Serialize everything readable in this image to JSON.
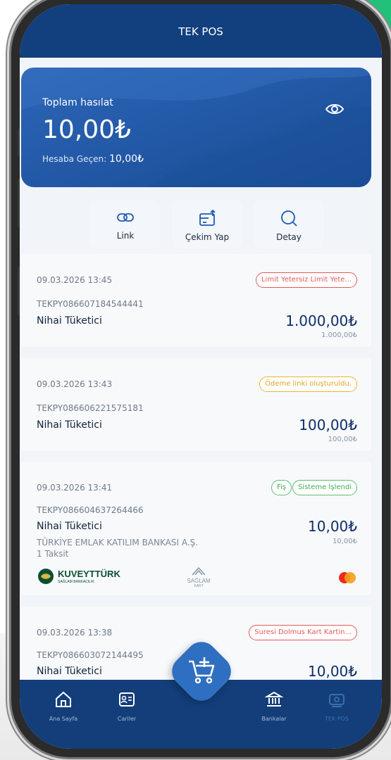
{
  "app": {
    "title": "TEK POS"
  },
  "summary": {
    "total_label": "Toplam hasılat",
    "total_amount": "10,00₺",
    "transferred_label": "Hesaba Geçen:",
    "transferred_amount": "10,00₺"
  },
  "actions": [
    {
      "label": "Link",
      "icon": "link-icon"
    },
    {
      "label": "Çekim Yap",
      "icon": "withdraw-icon"
    },
    {
      "label": "Detay",
      "icon": "search-icon"
    }
  ],
  "transactions": [
    {
      "datetime": "09.03.2026 13:45",
      "code": "TEKPY086607184544441",
      "customer": "Nihai Tüketici",
      "amount": "1.000,00₺",
      "amount_small": "1.000,00₺",
      "badges": [
        {
          "text": "Limit Yetersiz Limit Yete...",
          "color": "#e45959"
        }
      ]
    },
    {
      "datetime": "09.03.2026 13:43",
      "code": "TEKPY086606221575181",
      "customer": "Nihai Tüketici",
      "amount": "100,00₺",
      "amount_small": "100,00₺",
      "badges": [
        {
          "text": "Ödeme linki oluşturuldu.",
          "color": "#f0b429"
        }
      ]
    },
    {
      "datetime": "09.03.2026 13:41",
      "code": "TEKPY086604637264466",
      "customer": "Nihai Tüketici",
      "amount": "10,00₺",
      "amount_small": "10,00₺",
      "bank": "TÜRKİYE EMLAK KATILIM BANKASI A.Ş.",
      "installment": "1 Taksit",
      "badges": [
        {
          "text": "Fiş",
          "color": "#5fbf6b"
        },
        {
          "text": "Sisteme İşlendi",
          "color": "#5fbf6b"
        }
      ],
      "logos": {
        "bank_logo": "KUVEYTTÜRK",
        "bank_logo_sub": "SAĞLAM BANKACILIK",
        "card_program": "SAĞLAM",
        "card_program_sub": "KART",
        "network": "mastercard"
      }
    },
    {
      "datetime": "09.03.2026 13:38",
      "code": "TEKPY086603072144495",
      "customer": "Nihai Tüketici",
      "amount": "10,00₺",
      "badges": [
        {
          "text": "Suresi Dolmus Kart Kartin...",
          "color": "#e45959"
        }
      ]
    }
  ],
  "nav": {
    "items": [
      {
        "label": "Ana Sayfa",
        "icon": "home-icon"
      },
      {
        "label": "Cariler",
        "icon": "contacts-icon"
      },
      {
        "label": "Bankalar",
        "icon": "bank-icon"
      },
      {
        "label": "TEK POS",
        "icon": "pos-icon",
        "active": true
      }
    ],
    "fab_icon": "add-to-cart-icon"
  },
  "colors": {
    "primary": "#123f7e",
    "hero": "#2d66b8",
    "accent_green": "#21c17a",
    "error": "#e45959",
    "warning": "#f0b429",
    "success": "#5fbf6b"
  }
}
